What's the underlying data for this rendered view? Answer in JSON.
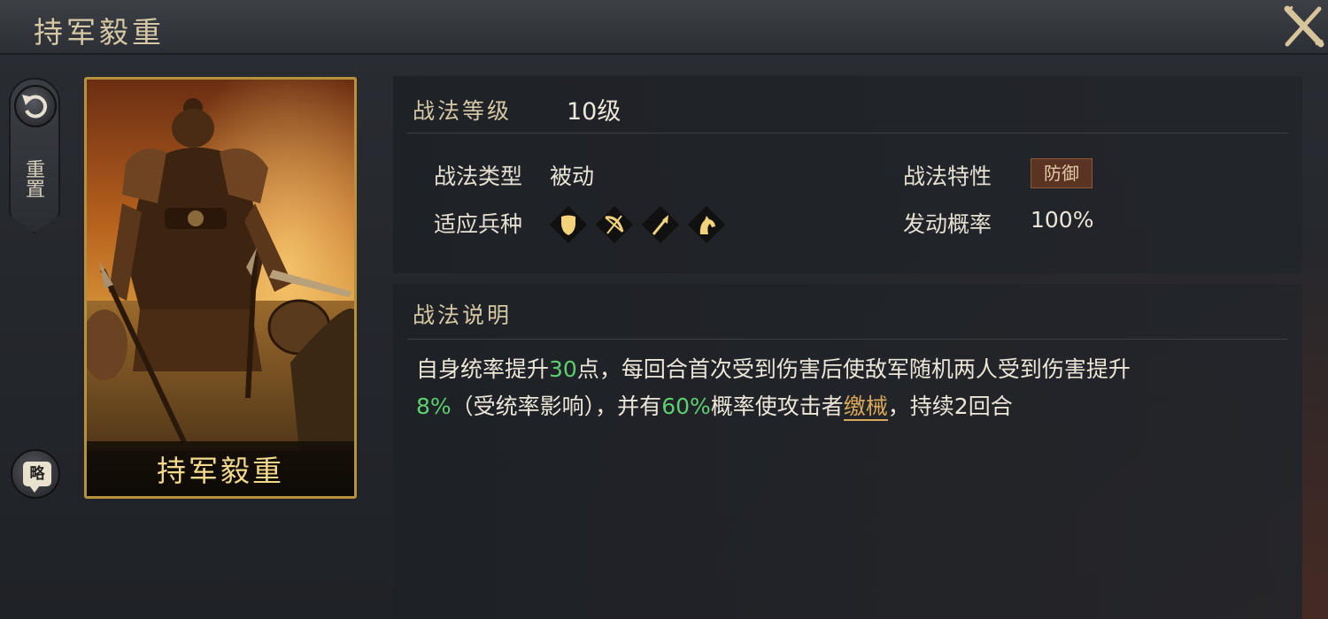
{
  "header": {
    "title": "持军毅重"
  },
  "sidebar": {
    "reset_label": "重置",
    "strategy_label": "略"
  },
  "card": {
    "name": "持军毅重"
  },
  "level": {
    "label": "战法等级",
    "value": "10级"
  },
  "attributes": {
    "type_label": "战法类型",
    "type_value": "被动",
    "troops_label": "适应兵种",
    "troops": [
      "shield-icon",
      "bow-icon",
      "spear-icon",
      "horse-icon"
    ],
    "trait_label": "战法特性",
    "trait_value": "防御",
    "chance_label": "发动概率",
    "chance_value": "100%"
  },
  "description": {
    "title": "战法说明",
    "line1_a": "自身统率提升",
    "line1_num": "30",
    "line1_b": "点，每回合首次受到伤害后使敌军随机两人受到伤害提升",
    "line2_num1": "8%",
    "line2_a": "（受统率影响），并有",
    "line2_num2": "60%",
    "line2_b": "概率使攻击者",
    "line2_term": "缴械",
    "line2_c": "，持续2回合"
  },
  "colors": {
    "accent_gold": "#d6c8a4",
    "highlight_green": "#5ccf6f",
    "term_orange": "#d9a95a"
  }
}
